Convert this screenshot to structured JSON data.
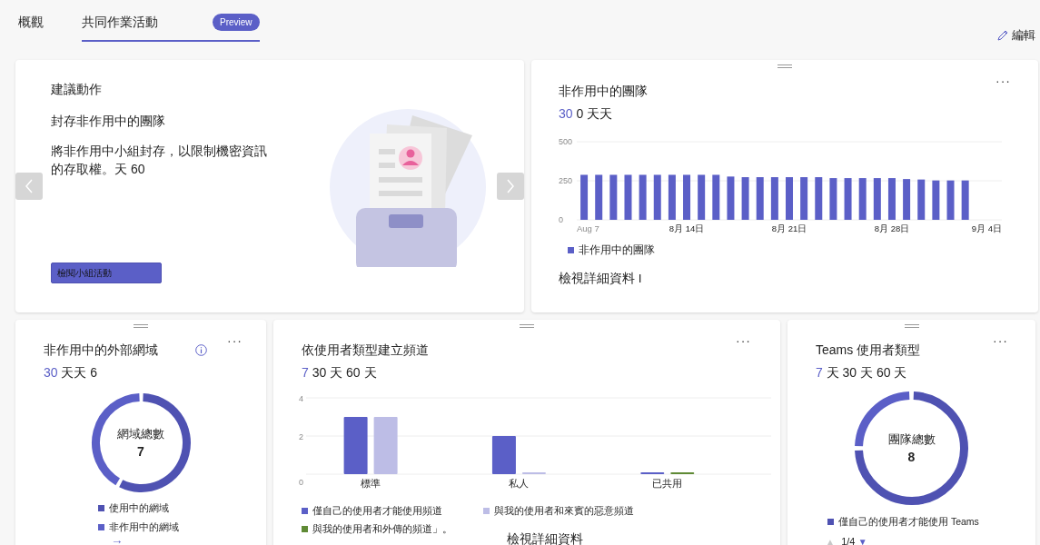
{
  "tabs": [
    {
      "label": "概觀",
      "selected": false
    },
    {
      "label": "共同作業活動",
      "selected": true,
      "badge": "Preview"
    }
  ],
  "edit_button": {
    "label": "編輯"
  },
  "recommendation": {
    "heading": "建議動作",
    "title": "封存非作用中的團隊",
    "description": "將非作用中小組封存，以限制機密資訊的存取權。天 60",
    "button": "檢閱小組活動"
  },
  "inactive_teams": {
    "title": "非作用中的團隊",
    "periods": [
      {
        "label": "30",
        "selected": true
      },
      {
        "label": "0 天天",
        "selected": false
      }
    ],
    "more_button": "···",
    "chart_data": {
      "type": "bar",
      "categories": [
        "Aug 7",
        null,
        null,
        null,
        null,
        null,
        null,
        "8月 14日",
        null,
        null,
        null,
        null,
        null,
        null,
        "8月 21日",
        null,
        null,
        null,
        null,
        null,
        null,
        "8月 28日",
        null,
        null,
        null,
        null,
        null,
        null,
        "9月 4日"
      ],
      "series": [
        {
          "name": "非作用中的團隊",
          "color": "#5b5fc7",
          "values": [
            288,
            288,
            288,
            288,
            288,
            288,
            288,
            288,
            288,
            288,
            277,
            273,
            273,
            273,
            273,
            273,
            273,
            267,
            267,
            267,
            267,
            267,
            261,
            258,
            252,
            252,
            252,
            null,
            null
          ]
        }
      ],
      "ylim": [
        0,
        500
      ],
      "yticks": [
        0,
        250,
        500
      ]
    },
    "link": "檢視詳細資料 I"
  },
  "inactive_domains": {
    "title": "非作用中的外部網域",
    "more_button": "···",
    "periods": [
      {
        "label": "30",
        "selected": true
      },
      {
        "label": "天天 6",
        "selected": false
      }
    ],
    "center_label": "網域總數",
    "center_value": "7",
    "legend": [
      {
        "label": "使用中的網域",
        "color": "#4f52b2"
      },
      {
        "label": "非作用中的網域",
        "color": "#5b5fc7"
      }
    ],
    "link": "→"
  },
  "channels": {
    "title": "依使用者類型建立頻道",
    "more_button": "···",
    "periods": [
      {
        "label": "7",
        "selected": true
      },
      {
        "label": "30 天 60 天",
        "selected": false
      }
    ],
    "chart_data": {
      "type": "bar",
      "categories": [
        "標準",
        "私人",
        "已共用"
      ],
      "series": [
        {
          "name": "僅自己的使用者才能使用頻道",
          "color": "#5b5fc7",
          "values": [
            3,
            2,
            0
          ]
        },
        {
          "name": "與我的使用者和來賓的惡意頻道",
          "color": "#bdbde6",
          "values": [
            3,
            0,
            null
          ]
        },
        {
          "name": "與我的使用者和外傳的頻道」。",
          "color": "#5f8a35",
          "values": [
            null,
            null,
            0
          ]
        }
      ],
      "ylim": [
        0,
        4
      ],
      "yticks": [
        0,
        2,
        4
      ]
    },
    "link": "檢視詳細資料"
  },
  "user_types": {
    "title": "Teams 使用者類型",
    "more_button": "···",
    "periods": [
      {
        "label": "7",
        "selected": true
      },
      {
        "label": "天 30 天 60 天",
        "selected": false
      }
    ],
    "center_label": "團隊總數",
    "center_value": "8",
    "legend": [
      {
        "label": "僅自己的使用者才能使用 Teams",
        "color": "#4f52b2"
      }
    ],
    "pager": {
      "label": "1/4",
      "prev": "▲",
      "next": "▼",
      "prev_disabled": true,
      "next_disabled": false
    }
  }
}
